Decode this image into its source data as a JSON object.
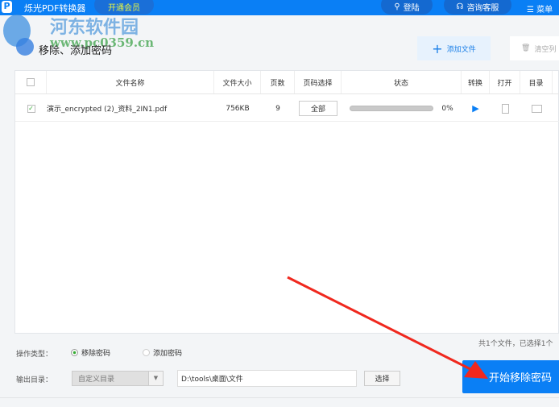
{
  "app": {
    "title": "烁光PDF转换器",
    "vip": "开通会员",
    "login": "登陆",
    "service": "咨询客服",
    "menu": "菜单"
  },
  "watermark": {
    "name": "河东软件园",
    "url": "www.pc0359.cn"
  },
  "page": {
    "title": "移除、添加密码",
    "add_file": "添加文件",
    "clear_list": "清空列"
  },
  "table": {
    "headers": [
      "文件名称",
      "文件大小",
      "页数",
      "页码选择",
      "状态",
      "转换",
      "打开",
      "目录"
    ],
    "rows": [
      {
        "checked": true,
        "name": "演示_encrypted (2)_资料_2IN1.pdf",
        "size": "756KB",
        "pages": "9",
        "page_select": "全部",
        "progress": 0,
        "progress_label": "0%"
      }
    ]
  },
  "footer": {
    "summary": "共1个文件，已选择1个",
    "op_type_label": "操作类型：",
    "op_remove": "移除密码",
    "op_add": "添加密码",
    "op_selected": "remove",
    "output_label": "输出目录：",
    "output_mode": "自定义目录",
    "output_path": "D:\\tools\\桌面\\文件",
    "choose": "选择",
    "start": "开始移除密码"
  },
  "colors": {
    "brand": "#0a7ff5",
    "arrow": "#f0281e"
  }
}
